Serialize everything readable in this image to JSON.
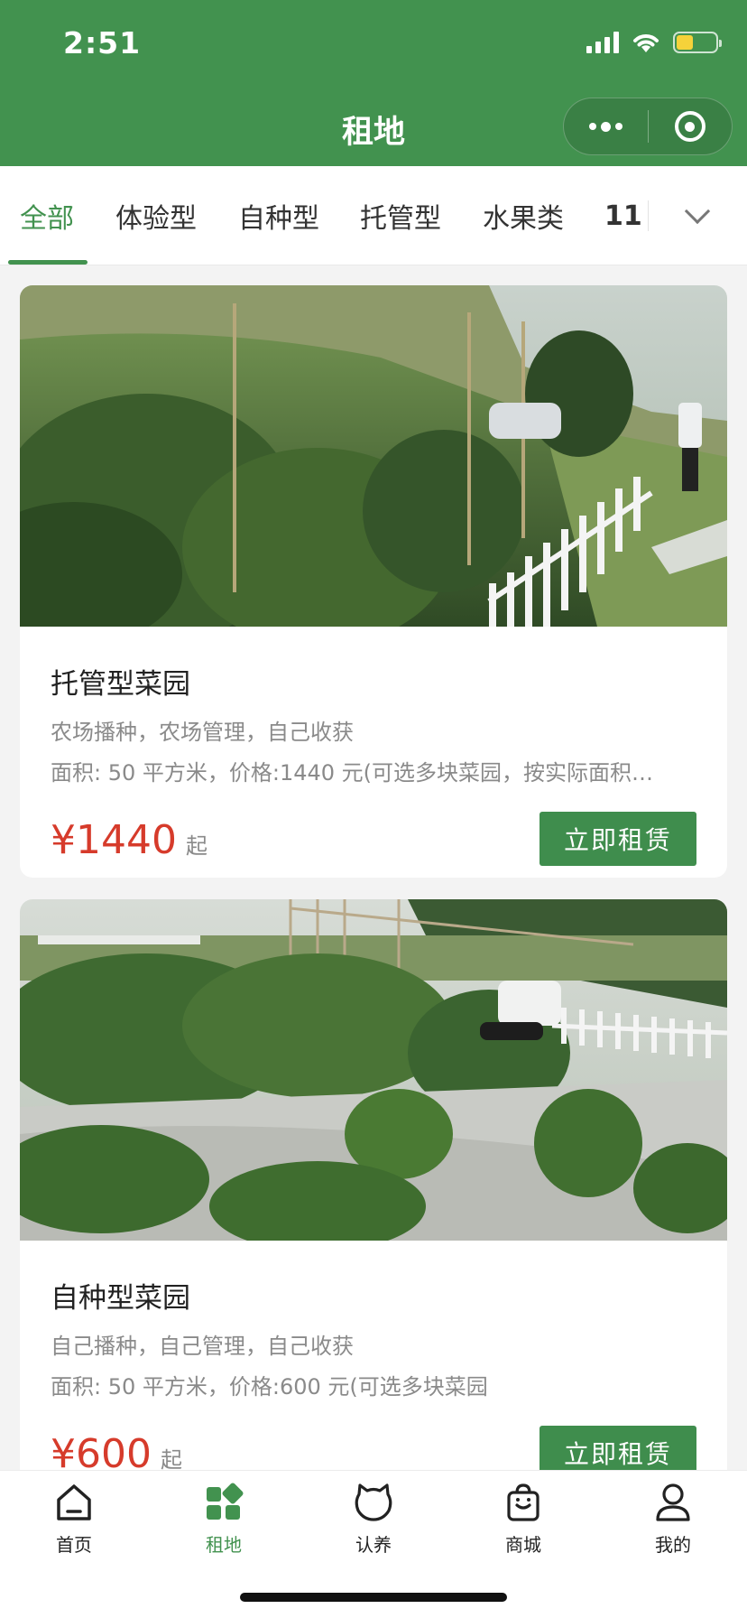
{
  "status_bar": {
    "time": "2:51",
    "battery_level": 0.42,
    "battery_color": "#f5d23a"
  },
  "nav": {
    "title": "租地",
    "more_icon": "more-dots-icon",
    "close_icon": "target-icon"
  },
  "colors": {
    "brand": "#42924f",
    "price": "#d63b2b",
    "button": "#3f8d4d"
  },
  "tabs": [
    {
      "label": "全部",
      "active": true
    },
    {
      "label": "体验型"
    },
    {
      "label": "自种型"
    },
    {
      "label": "托管型"
    },
    {
      "label": "水果类"
    },
    {
      "label": "11"
    }
  ],
  "tabs_expand_icon": "chevron-down-icon",
  "cards": [
    {
      "title": "托管型菜园",
      "desc": "农场播种，农场管理，自己收获",
      "area": "面积: 50 平方米，价格:1440 元(可选多块菜园，按实际面积…",
      "price": "¥1440",
      "price_suffix": "起",
      "button": "立即租赁"
    },
    {
      "title": "自种型菜园",
      "desc": "自己播种，自己管理，自己收获",
      "area": "面积: 50 平方米，价格:600 元(可选多块菜园",
      "price": "¥600",
      "price_suffix": "起",
      "button": "立即租赁"
    }
  ],
  "tabbar": [
    {
      "label": "首页",
      "icon": "home-icon"
    },
    {
      "label": "租地",
      "icon": "grid-icon",
      "active": true
    },
    {
      "label": "认养",
      "icon": "cat-icon"
    },
    {
      "label": "商城",
      "icon": "shopping-bag-icon"
    },
    {
      "label": "我的",
      "icon": "user-icon"
    }
  ]
}
